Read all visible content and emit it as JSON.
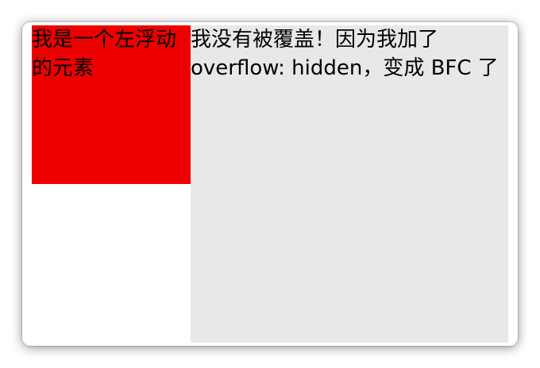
{
  "float_box": {
    "text": "我是一个左浮动的元素",
    "background": "#ee0000"
  },
  "bfc_box": {
    "text": "我没有被覆盖！因为我加了overflow: hidden，变成 BFC 了",
    "background": "#e8e8e8"
  }
}
